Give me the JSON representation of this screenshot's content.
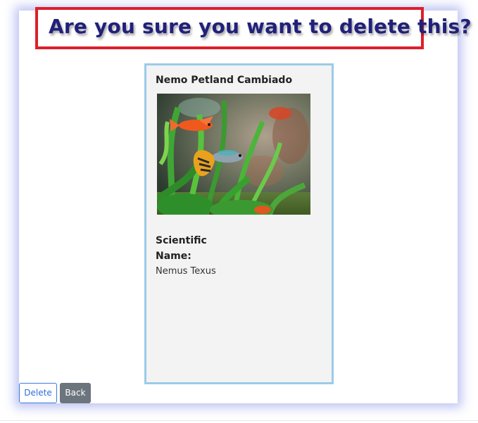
{
  "dialog": {
    "title": "Are you sure you want to delete this?"
  },
  "card": {
    "name": "Nemo Petland Cambiado",
    "photo_subject": "aquarium fish among green plants",
    "scientific_name_label": "Scientific Name:",
    "scientific_name_value": "Nemus Texus"
  },
  "actions": {
    "delete_label": "Delete",
    "back_label": "Back"
  },
  "colors": {
    "title_text": "#21207a",
    "title_border": "#dd1f2b",
    "card_border": "#9ccbe8",
    "card_background": "#f3f3f3",
    "delete_button_text": "#2f6fd8",
    "back_button_background": "#6c757d"
  }
}
